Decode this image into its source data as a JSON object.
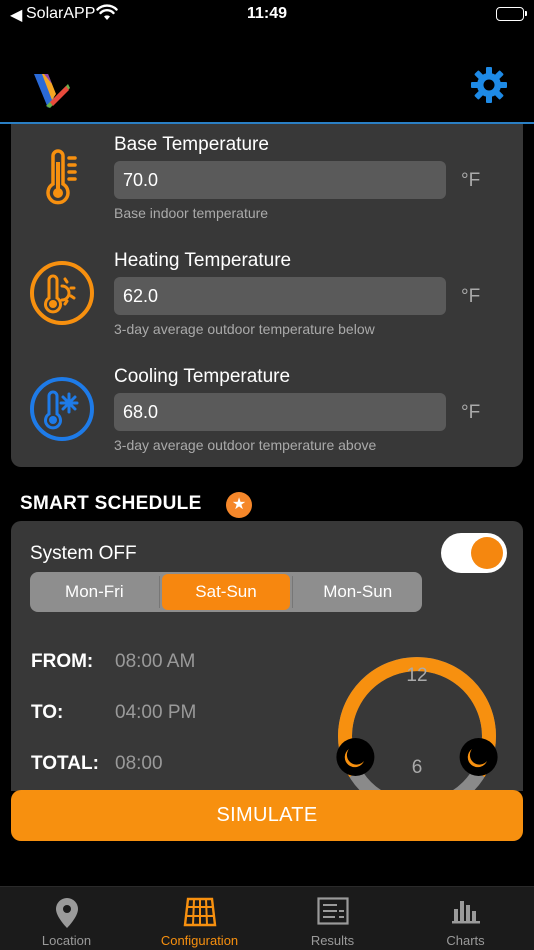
{
  "status_bar": {
    "back_glyph": "◀",
    "app_name": "SolarAPP",
    "time": "11:49"
  },
  "header": {
    "logo_icon": "app-logo-icon",
    "settings_icon": "gear-icon"
  },
  "temperatures": [
    {
      "title": "Base Temperature",
      "value": "70.0",
      "unit": "°F",
      "hint": "Base indoor temperature",
      "icon": "thermometer-icon"
    },
    {
      "title": "Heating Temperature",
      "value": "62.0",
      "unit": "°F",
      "hint": "3-day average outdoor temperature below",
      "icon": "thermometer-sun-icon"
    },
    {
      "title": "Cooling Temperature",
      "value": "68.0",
      "unit": "°F",
      "hint": "3-day average outdoor temperature above",
      "icon": "thermometer-snowflake-icon"
    }
  ],
  "smart_schedule": {
    "title": "SMART SCHEDULE",
    "badge_icon": "star-icon",
    "system_label": "System OFF",
    "system_on": true,
    "segments": [
      "Mon-Fri",
      "Sat-Sun",
      "Mon-Sun"
    ],
    "selected_segment": "Sat-Sun",
    "from_label": "FROM:",
    "from_value": "08:00 AM",
    "to_label": "TO:",
    "to_value": "04:00 PM",
    "total_label": "TOTAL:",
    "total_value": "08:00",
    "dial": {
      "top_label": "12",
      "bottom_label": "6"
    }
  },
  "simulate_label": "SIMULATE",
  "tabs": [
    {
      "label": "Location",
      "icon": "location-pin-icon",
      "active": false
    },
    {
      "label": "Configuration",
      "icon": "solar-panel-icon",
      "active": true
    },
    {
      "label": "Results",
      "icon": "results-list-icon",
      "active": false
    },
    {
      "label": "Charts",
      "icon": "bar-chart-icon",
      "active": false
    }
  ],
  "colors": {
    "accent": "#F7900F",
    "header_line": "#2A7FC4",
    "card_bg": "#383838",
    "cold_blue": "#1E7BE8"
  }
}
